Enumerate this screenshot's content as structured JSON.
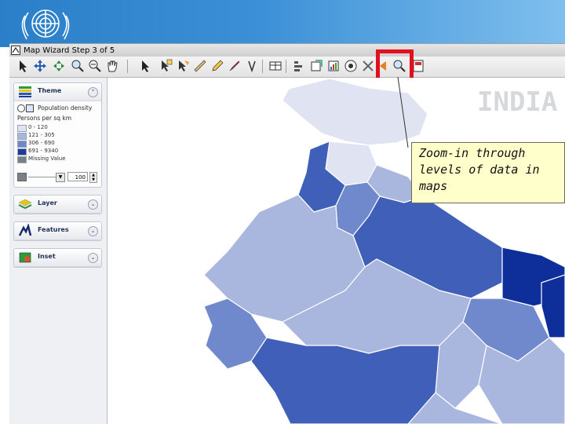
{
  "window": {
    "title": "Map Wizard   Step 3 of 5"
  },
  "toolbar": {
    "highlighted_tool": "zoom-in-tool",
    "tools": [
      "select-arrow",
      "pan-move",
      "zoom-to-fit",
      "zoom-in",
      "zoom-out",
      "pan-hand",
      "pointer",
      "select-feature",
      "select-region",
      "ruler",
      "pencil",
      "brush",
      "label-tool",
      "info-tool",
      "table-tool",
      "layer-properties",
      "export-tool",
      "chart-tool",
      "hide-tool",
      "nav-arrow",
      "target-zoom",
      "zoom-in-tool",
      "close-window"
    ]
  },
  "sidebar": {
    "theme_panel": {
      "title": "Theme",
      "indicator": "Population density",
      "unit_label": "Persons per sq km",
      "legend": [
        {
          "label": "0 - 120",
          "color": "#dfe3f2"
        },
        {
          "label": "121 - 305",
          "color": "#a9b6de"
        },
        {
          "label": "306 - 690",
          "color": "#6f86c8"
        },
        {
          "label": "691 - 9340",
          "color": "#1d3a9c"
        },
        {
          "label": "Missing Value",
          "color": "#7b7f86"
        }
      ],
      "transparency_value": "100"
    },
    "layer_panel": {
      "title": "Layer"
    },
    "features_panel": {
      "title": "Features"
    },
    "inset_panel": {
      "title": "Inset"
    }
  },
  "map": {
    "country_label": "INDIA",
    "palette": {
      "lightest": "#dfe3f2",
      "light": "#a9b6de",
      "medium": "#7089cc",
      "dark": "#3f5fb8",
      "darkest": "#0e2e9a"
    }
  },
  "callout": {
    "text": "Zoom-in through\nlevels of data in\nmaps"
  },
  "colors": {
    "banner": "#2b7fc8",
    "highlight": "#e2101c",
    "callout_bg": "#ffffcc"
  }
}
